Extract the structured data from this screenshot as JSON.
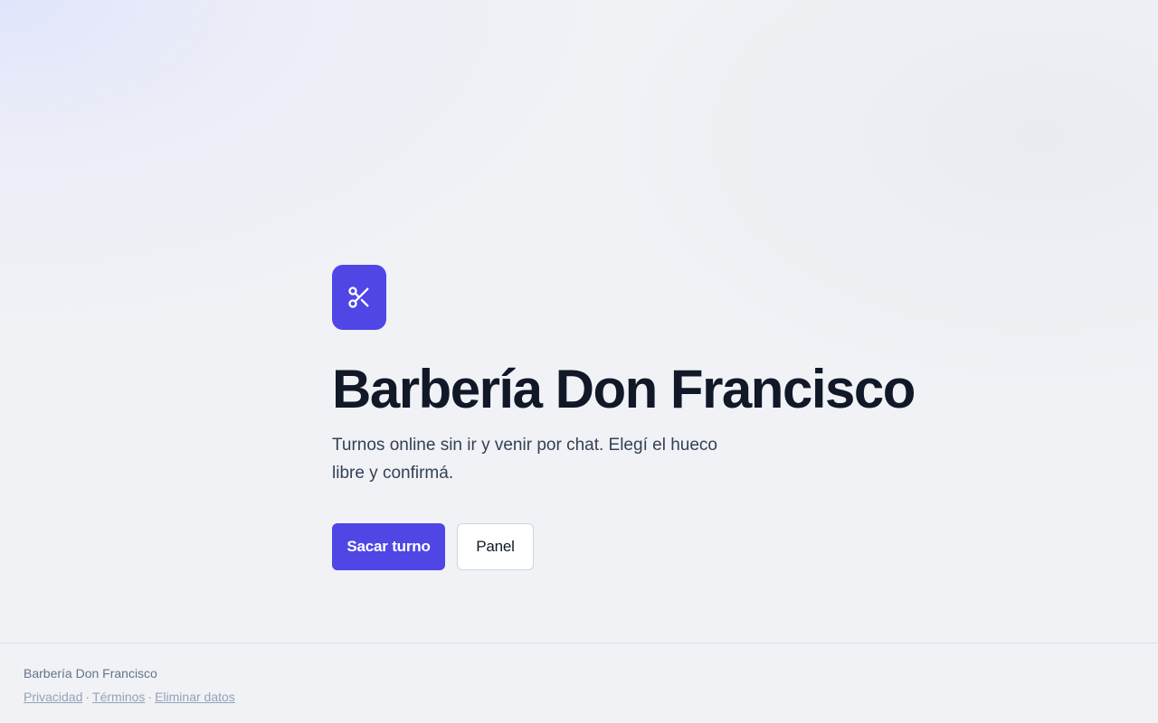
{
  "hero": {
    "icon": "scissors-icon",
    "title": "Barbería Don Francisco",
    "subtitle": "Turnos online sin ir y venir por chat. Elegí el hueco libre y confirmá.",
    "primary_button": "Sacar turno",
    "secondary_button": "Panel"
  },
  "footer": {
    "brand": "Barbería Don Francisco",
    "links": [
      "Privacidad",
      "Términos",
      "Eliminar datos"
    ],
    "separator": "·"
  },
  "colors": {
    "accent": "#4f46e5",
    "background": "#f0f2f6",
    "title": "#111827",
    "muted": "#64748b"
  }
}
